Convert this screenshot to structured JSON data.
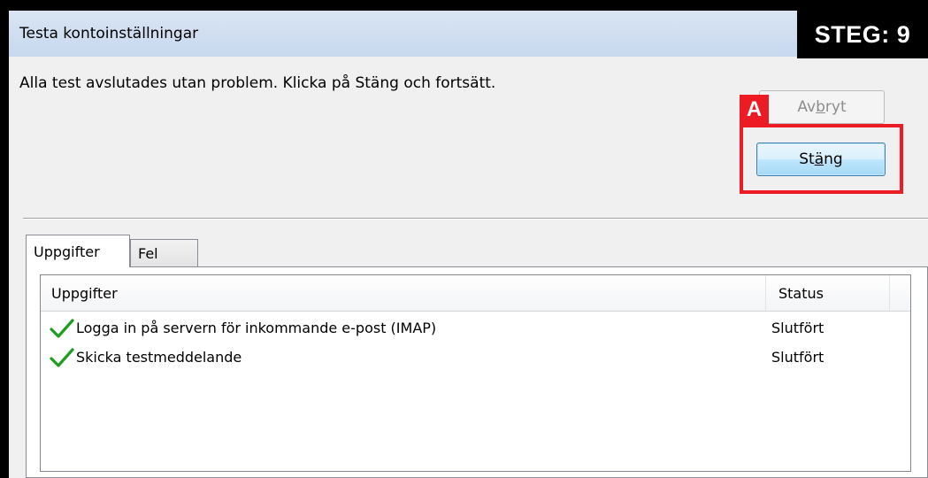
{
  "window": {
    "title": "Testa kontoinställningar",
    "step_label": "STEG: 9"
  },
  "message": "Alla test avslutades utan problem. Klicka på Stäng och fortsätt.",
  "buttons": {
    "cancel": {
      "label_pre": "Av",
      "label_key": "b",
      "label_post": "ryt",
      "enabled": false
    },
    "close": {
      "label_pre": "St",
      "label_key": "ä",
      "label_post": "ng",
      "enabled": true
    }
  },
  "annotation": {
    "label": "A",
    "color": "#ed1c24"
  },
  "tabs": [
    {
      "label": "Uppgifter",
      "active": true
    },
    {
      "label": "Fel",
      "active": false
    }
  ],
  "table": {
    "columns": [
      "Uppgifter",
      "Status"
    ],
    "rows": [
      {
        "icon": "checkmark-icon",
        "task": "Logga in på servern för inkommande e-post (IMAP)",
        "status": "Slutfört"
      },
      {
        "icon": "checkmark-icon",
        "task": "Skicka testmeddelande",
        "status": "Slutfört"
      }
    ]
  },
  "colors": {
    "check": "#1e9e1e",
    "highlight": "#ed1c24"
  }
}
